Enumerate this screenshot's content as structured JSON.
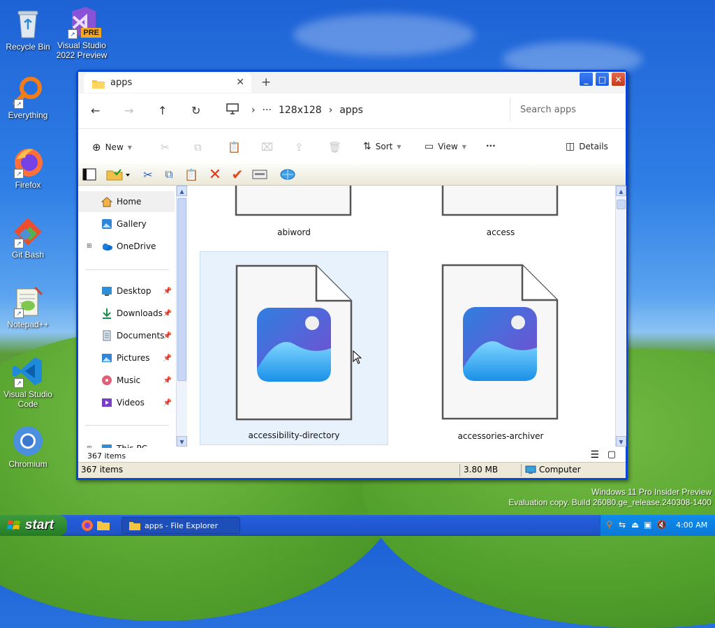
{
  "desktop": {
    "icons": [
      {
        "label": "Recycle Bin"
      },
      {
        "label": "Visual Studio 2022 Preview",
        "badge": "PRE"
      },
      {
        "label": "Everything"
      },
      {
        "label": "Firefox"
      },
      {
        "label": "Git Bash"
      },
      {
        "label": "Notepad++"
      },
      {
        "label": "Visual Studio Code"
      },
      {
        "label": "Chromium"
      }
    ],
    "watermark": {
      "line1": "Windows 11 Pro Insider Preview",
      "line2": "Evaluation copy. Build 26080.ge_release.240308-1400"
    }
  },
  "window": {
    "tab_title": "apps",
    "address": {
      "crumbs": [
        "128x128",
        "apps"
      ],
      "overflow": "···",
      "search_placeholder": "Search apps"
    },
    "commandbar": {
      "new_label": "New",
      "sort_label": "Sort",
      "view_label": "View",
      "more_label": "···",
      "details_label": "Details"
    },
    "navpane": {
      "top": [
        {
          "label": "Home"
        },
        {
          "label": "Gallery"
        },
        {
          "label": "OneDrive"
        }
      ],
      "pinned": [
        {
          "label": "Desktop"
        },
        {
          "label": "Downloads"
        },
        {
          "label": "Documents"
        },
        {
          "label": "Pictures"
        },
        {
          "label": "Music"
        },
        {
          "label": "Videos"
        }
      ],
      "bottom": {
        "label": "This PC"
      }
    },
    "files": [
      {
        "name": "abiword"
      },
      {
        "name": "access"
      },
      {
        "name": "accessibility-directory"
      },
      {
        "name": "accessories-archiver"
      }
    ],
    "status": {
      "items": "367 items",
      "xp_items": "367 items",
      "size": "3.80 MB",
      "location": "Computer"
    }
  },
  "taskbar": {
    "start_label": "start",
    "task_label": "apps - File Explorer",
    "clock": "4:00 AM"
  },
  "colors": {
    "xp_blue": "#0a46d8",
    "start_green": "#2e8a2e",
    "selection": "#e8f2fd"
  }
}
